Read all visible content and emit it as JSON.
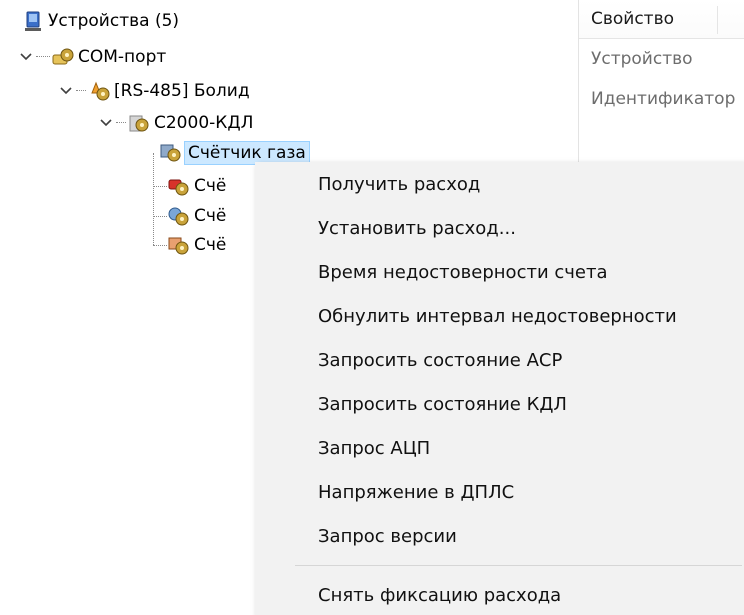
{
  "tree": {
    "root": {
      "label": "Устройства (5)",
      "icon": "devices-computer-icon"
    },
    "com_port": {
      "label": "COM-порт",
      "icon": "com-port-icon"
    },
    "bolid": {
      "label": "[RS-485] Болид",
      "icon": "rs485-bus-icon"
    },
    "kdl": {
      "label": "С2000-КДЛ",
      "icon": "controller-icon"
    },
    "children": [
      {
        "label": "Счётчик газа",
        "visible_label": "Счётчик газа",
        "icon": "gas-meter-icon",
        "selected": true
      },
      {
        "label": "Счё",
        "icon": "heat-meter-icon",
        "selected": false
      },
      {
        "label": "Счё",
        "icon": "water-meter-icon",
        "selected": false
      },
      {
        "label": "Счё",
        "icon": "electricity-meter-icon",
        "selected": false
      }
    ]
  },
  "properties": {
    "header": "Свойство",
    "rows": [
      "Устройство",
      "Идентификатор"
    ]
  },
  "context_menu": {
    "items": [
      "Получить расход",
      "Установить расход...",
      "Время недостоверности счета",
      "Обнулить интервал недостоверности",
      "Запросить состояние АСР",
      "Запросить состояние КДЛ",
      "Запрос АЦП",
      "Напряжение в ДПЛС",
      "Запрос версии"
    ],
    "after_separator": [
      "Снять фиксацию расхода"
    ]
  }
}
